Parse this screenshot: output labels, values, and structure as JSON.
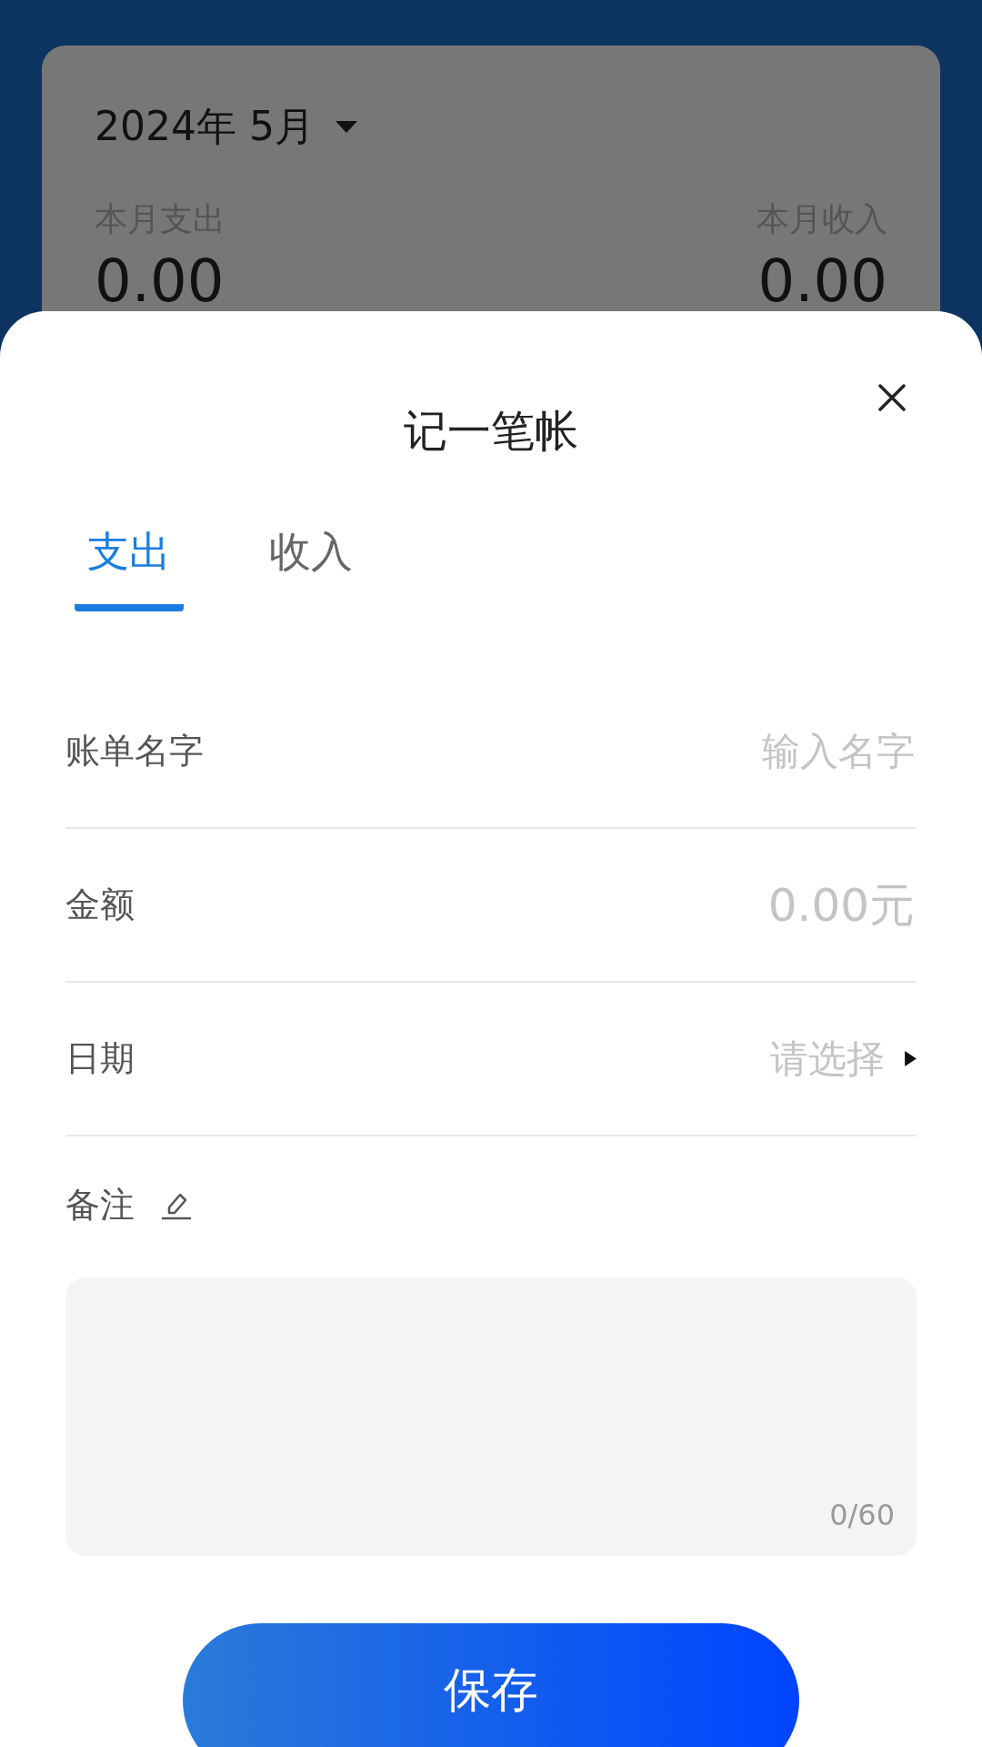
{
  "header": {
    "month": "2024年 5月",
    "summary": [
      {
        "label": "本月支出",
        "amount": "0.00"
      },
      {
        "label": "本月收入",
        "amount": "0.00"
      }
    ]
  },
  "sheet": {
    "title": "记一笔帐",
    "tabs": [
      {
        "label": "支出",
        "selected": true
      },
      {
        "label": "收入",
        "selected": false
      }
    ],
    "fields": [
      {
        "kind": "text",
        "label": "账单名字",
        "placeholder": "输入名字"
      },
      {
        "kind": "amount",
        "label": "金额",
        "placeholder": "0.00元"
      },
      {
        "kind": "picker",
        "label": "日期",
        "placeholder": "请选择"
      }
    ],
    "note": {
      "label": "备注",
      "counter": "0/60"
    },
    "save_button": "保存"
  }
}
